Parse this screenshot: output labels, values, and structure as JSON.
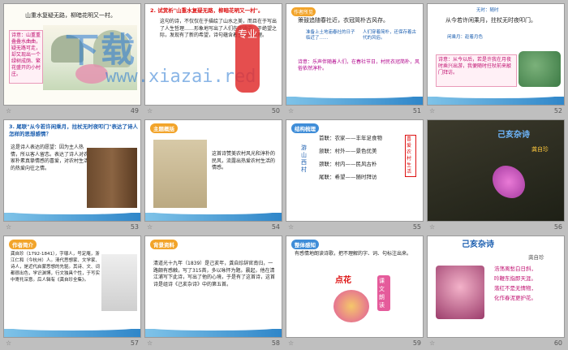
{
  "slides": [
    {
      "num": "49",
      "line1": "山重水复疑无路，柳暗花明又一村。",
      "box": "诗意：山重重叠叠水曲曲，疑无路可走，却又现出一个绿树成荫、繁花盛开的小村庄。"
    },
    {
      "num": "50",
      "title": "2. 试赏析\"山重水复疑无路，柳暗花明又一村\"。",
      "body": "这句的诗，不仅仅在于描绘了山水之美，而且在于写出了人生哲理……形象地写出了人们在困境中，于绝望之际，发现有了新的希望，诗句蕴含着生活的哲理。"
    },
    {
      "num": "51",
      "tag": "作者所见",
      "line1": "箫鼓追随春社近，衣冠简朴古风存。",
      "n1": "准备上土地庙春社的日子临近了……",
      "n2": "人们穿着简朴，还保存着古代的风俗。",
      "foot": "诗意：乐声伴随着人们，在春社节日，村民衣冠简朴，风俗依然淳朴。"
    },
    {
      "num": "52",
      "line1": "从今若许闲乘月，拄杖无时夜叩门。",
      "n1": "闲乘月：趁着月色",
      "n2": "无时：随时",
      "foot": "诗意：从今以后，若是许我在月夜时乘兴出游，我便随时拄杖前来敲门拜访。"
    },
    {
      "num": "53",
      "title": "3. 尾联\"从今若许闲乘月，拄杖无时夜叩门\"表达了诗人怎样的思想感情？",
      "body": "这是诗人表达的愿望：因为主人热情，所以客人留恋。表达了诗人对农家朴素真挚情感的喜爱，对农村生活的热爱向往之情。"
    },
    {
      "num": "54",
      "pill": "主题概括",
      "body": "这首诗赞美农村风光和淳朴的民风，流露出热爱农村生活的情感。"
    },
    {
      "num": "55",
      "pill": "结构梳理",
      "side": "游山西村",
      "rows": [
        "首联：农家——丰年足食物",
        "颔联：村外——景色优美",
        "颈联：村内——民风古朴",
        "尾联：希望——随时拜访"
      ],
      "right": "喜爱农村生活",
      "title2": ""
    },
    {
      "num": "56",
      "title": "己亥杂诗",
      "author": "龚自珍"
    },
    {
      "num": "57",
      "pill": "作者简介",
      "body": "龚自珍（1792-1841），字璱人，号定庵，浙江仁和（今杭州）人。清代思想家、文学家、诗人，是近代启蒙思想的先驱。其诗、文、词都很出色，学识渊博，行文独具个性，于写实中寄托深意。后人辑有《龚自珍全集》。"
    },
    {
      "num": "58",
      "pill": "背景资料",
      "body": "清道光十九年（1839）是己亥年，龚自珍辞官南归，一路颇有感触，写了315首，多以咏怀为题。晨起，他在清江浦写下此诗，写出了他的心境，于是有了这首诗，这首诗是组诗《己亥杂诗》中的第五首。"
    },
    {
      "num": "59",
      "pill": "整体感知",
      "body": "有感情地朗读诗歌，把不理解的字、词、句标注出来。",
      "stamp": "点花",
      "side": "课文朗读"
    },
    {
      "num": "60",
      "title": "己亥杂诗",
      "author": "龚自珍",
      "lines": [
        "浩荡离愁白日斜，",
        "吟鞭东指即天涯。",
        "落红不是无情物，",
        "化作春泥更护花。"
      ]
    }
  ],
  "watermark": "下载",
  "watermark_sub": "www.xiazai.red",
  "mark": "专业",
  "star_icon": "☆"
}
